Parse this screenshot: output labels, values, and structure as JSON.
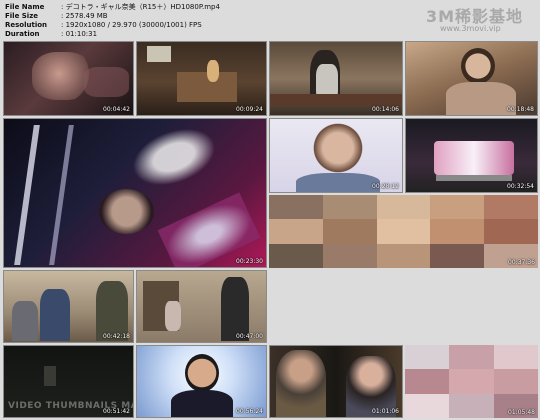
{
  "file_info": {
    "name_label": "File Name",
    "name_value": "デコトラ・ギャル奈美（R15＋）HD1080P.mp4",
    "size_label": "File Size",
    "size_value": "2578.49 MB",
    "resolution_label": "Resolution",
    "resolution_value": "1920x1080 / 29.970 (30000/1001) FPS",
    "duration_label": "Duration",
    "duration_value": "01:10:31"
  },
  "watermark": {
    "brand": "3M稀影基地",
    "url": "www.3movi.vip"
  },
  "thumbnails": [
    {
      "timestamp": "00:04:42"
    },
    {
      "timestamp": "00:09:24"
    },
    {
      "timestamp": "00:14:06"
    },
    {
      "timestamp": "00:18:48"
    },
    {
      "timestamp": "00:23:30"
    },
    {
      "timestamp": "00:28:12"
    },
    {
      "timestamp": "00:32:54"
    },
    {
      "timestamp": "00:37:36"
    },
    {
      "timestamp": "00:42:18"
    },
    {
      "timestamp": "00:47:00"
    },
    {
      "timestamp": "00:51:42"
    },
    {
      "timestamp": "00:56:24"
    },
    {
      "timestamp": "01:01:06"
    },
    {
      "timestamp": "01:05:48"
    }
  ],
  "footer_text": "VIDEO THUMBNAILS MA",
  "colors": {
    "background": "#dcdcdc",
    "timestamp": "#ffffff"
  }
}
